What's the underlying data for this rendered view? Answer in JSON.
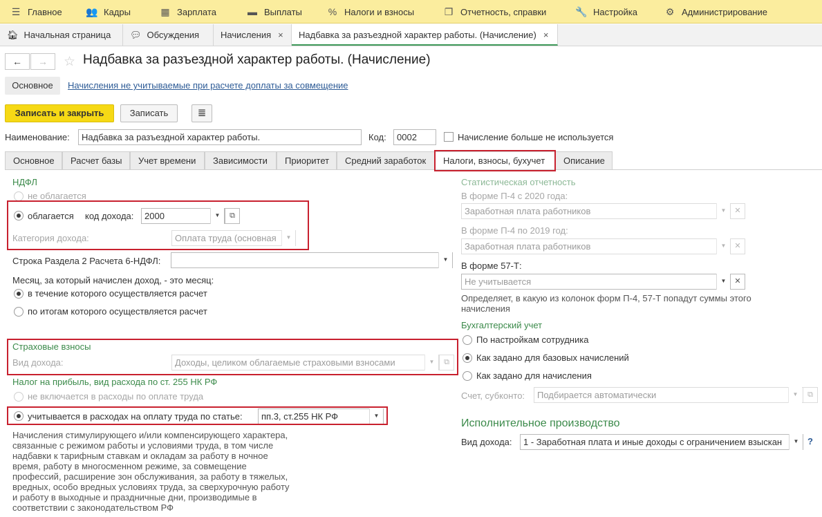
{
  "top_menu": [
    {
      "label": "Главное",
      "icon": "menu-icon"
    },
    {
      "label": "Кадры",
      "icon": "people-icon"
    },
    {
      "label": "Зарплата",
      "icon": "calculator-icon"
    },
    {
      "label": "Выплаты",
      "icon": "wallet-icon"
    },
    {
      "label": "Налоги и взносы",
      "icon": "percent-icon"
    },
    {
      "label": "Отчетность, справки",
      "icon": "documents-icon"
    },
    {
      "label": "Настройка",
      "icon": "wrench-icon"
    },
    {
      "label": "Администрирование",
      "icon": "gear-icon"
    }
  ],
  "open_tabs": [
    {
      "label": "Начальная страница",
      "icon": "home-icon"
    },
    {
      "label": "Обсуждения",
      "icon": "chat-icon"
    },
    {
      "label": "Начисления",
      "close": "×"
    },
    {
      "label": "Надбавка за разъездной характер работы. (Начисление)",
      "close": "×"
    }
  ],
  "header": {
    "title": "Надбавка за разъездной характер работы. (Начисление)",
    "back_icon": "←",
    "forward_icon": "→",
    "star_icon": "☆"
  },
  "sections": {
    "main_label": "Основное",
    "link_label": "Начисления не учитываемые при расчете доплаты за совмещение"
  },
  "toolbar": {
    "save_close_label": "Записать и закрыть",
    "save_label": "Записать",
    "report_icon": "≣"
  },
  "form": {
    "name_label": "Наименование:",
    "name_value": "Надбавка за разъездной характер работы.",
    "code_label": "Код:",
    "code_value": "0002",
    "not_used_label": "Начисление больше не используется"
  },
  "tabs": [
    {
      "label": "Основное"
    },
    {
      "label": "Расчет базы"
    },
    {
      "label": "Учет времени"
    },
    {
      "label": "Зависимости"
    },
    {
      "label": "Приоритет"
    },
    {
      "label": "Средний заработок"
    },
    {
      "label": "Налоги, взносы, бухучет"
    },
    {
      "label": "Описание"
    }
  ],
  "ndfl": {
    "header": "НДФЛ",
    "not_taxed_label": "не облагается",
    "taxed_label": "облагается",
    "income_code_label": "код дохода:",
    "income_code_value": "2000",
    "category_label": "Категория дохода:",
    "category_value": "Оплата труда (основная",
    "line_6ndfl_label": "Строка Раздела 2 Расчета 6-НДФЛ:",
    "line_6ndfl_value": "",
    "month_question": "Месяц, за который начислен доход, - это месяц:",
    "month_option1": "в течение которого осуществляется расчет",
    "month_option2": "по итогам которого осуществляется расчет"
  },
  "insurance": {
    "header": "Страховые взносы",
    "income_type_label": "Вид дохода:",
    "income_type_value": "Доходы, целиком облагаемые страховыми взносами"
  },
  "profit_tax": {
    "header": "Налог на прибыль, вид расхода по ст. 255 НК РФ",
    "option_not_included": "не включается в расходы по оплате труда",
    "option_included": "учитывается в расходах на оплату труда по статье:",
    "article_value": "пп.3, ст.255 НК РФ",
    "description": "Начисления стимулирующего и/или компенсирующего характера, связанные с режимом работы и условиями труда, в том числе надбавки к тарифным ставкам и окладам за работу в ночное время, работу в многосменном режиме, за совмещение профессий, расширение зон обслуживания, за работу в тяжелых, вредных, особо вредных условиях труда, за сверхурочную работу и работу в выходные и праздничные дни, производимые в соответствии с законодательством РФ"
  },
  "statistics": {
    "header": "Статистическая отчетность",
    "p4_2020_label": "В форме П-4 с 2020 года:",
    "p4_2020_value": "Заработная плата работников",
    "p4_2019_label": "В форме П-4 по 2019 год:",
    "p4_2019_value": "Заработная плата работников",
    "f57t_label": "В форме 57-Т:",
    "f57t_placeholder": "Не учитывается",
    "description": "Определяет, в какую из колонок форм П-4, 57-Т попадут суммы этого начисления"
  },
  "accounting": {
    "header": "Бухгалтерский учет",
    "option1": "По настройкам сотрудника",
    "option2": "Как задано для базовых начислений",
    "option3": "Как задано для начисления",
    "account_label": "Счет, субконто:",
    "account_placeholder": "Подбирается автоматически"
  },
  "enforcement": {
    "header": "Исполнительное производство",
    "income_type_label": "Вид дохода:",
    "income_type_value": "1 - Заработная плата и иные доходы с ограничением взыскан",
    "help_label": "?"
  }
}
